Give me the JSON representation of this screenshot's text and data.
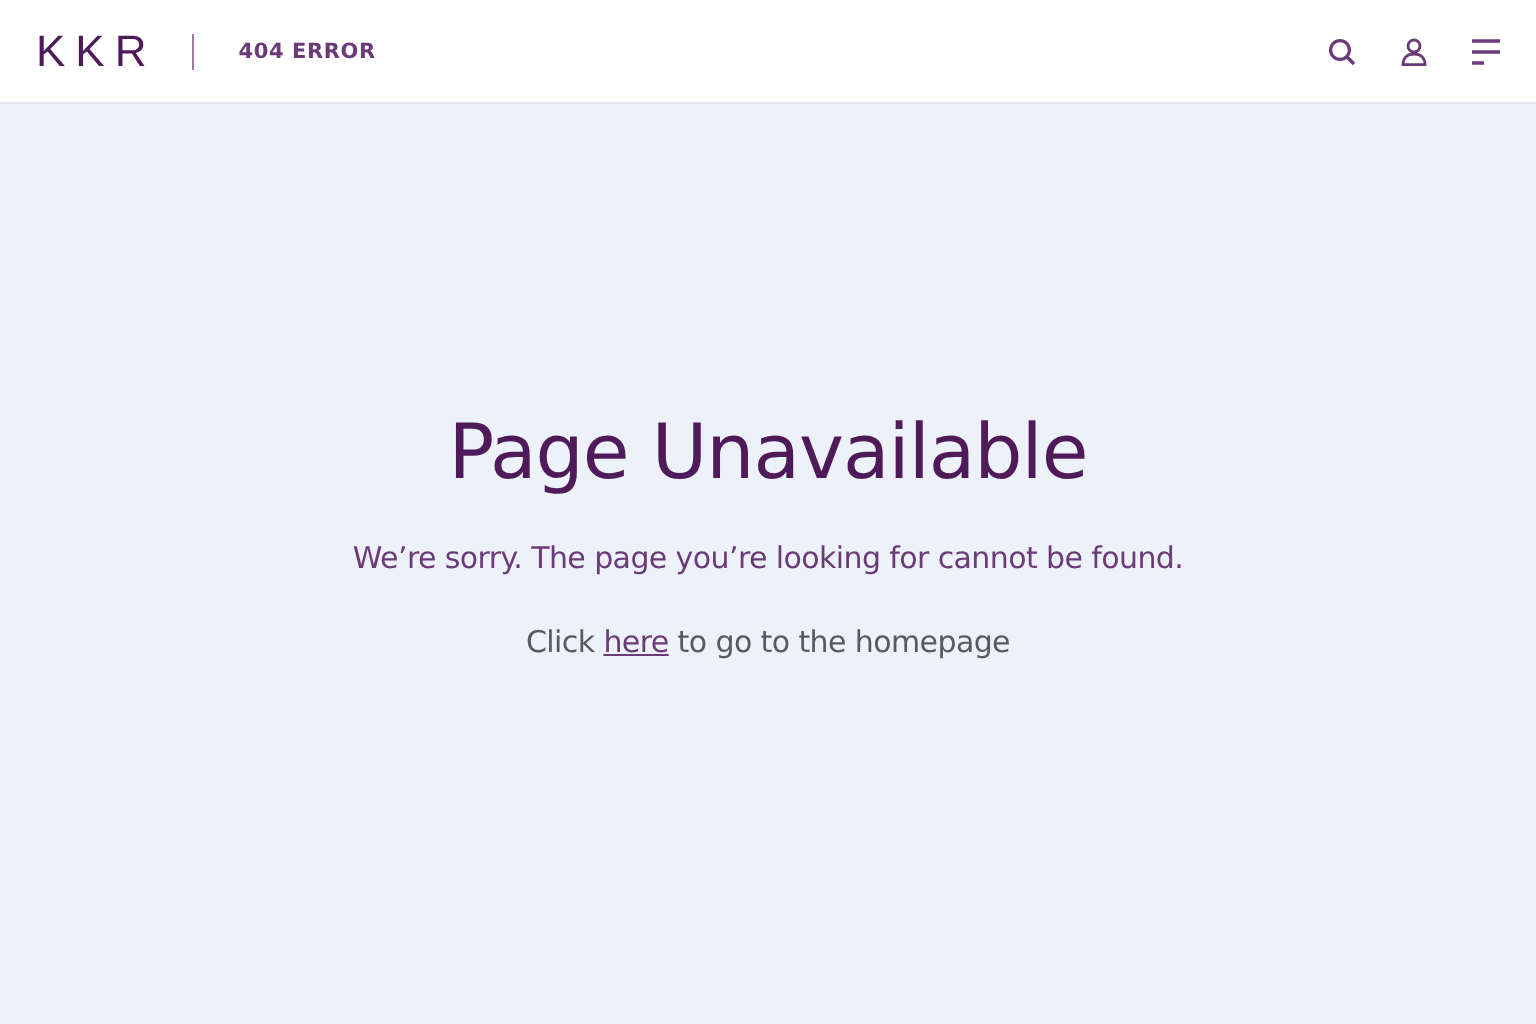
{
  "header": {
    "logo": "KKR",
    "section": "404 ERROR"
  },
  "main": {
    "title": "Page Unavailable",
    "message": "We’re sorry. The page you’re looking for cannot be found.",
    "link_line": {
      "before": "Click ",
      "link": "here",
      "after": " to go to the homepage"
    }
  }
}
